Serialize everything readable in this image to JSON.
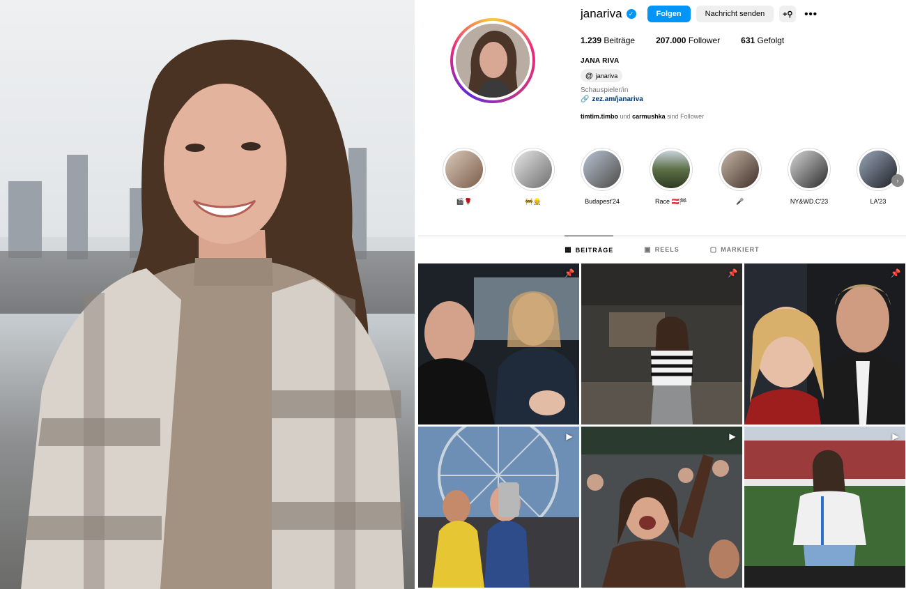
{
  "profile": {
    "username": "janariva",
    "follow_label": "Folgen",
    "message_label": "Nachricht senden",
    "add_user_icon": "add-person-icon",
    "more_icon": "more-dots-icon",
    "posts_count": "1.239",
    "posts_label": "Beiträge",
    "followers_count": "207.000",
    "followers_label": "Follower",
    "following_count": "631",
    "following_label": "Gefolgt",
    "full_name": "JANA RIVA",
    "threads_handle": "janariva",
    "category": "Schauspieler/in",
    "link": "zez.am/janariva",
    "followed_by_1": "timtim.timbo",
    "followed_by_and": "und",
    "followed_by_2": "carmushka",
    "followed_by_suffix": "sind Follower"
  },
  "highlights": [
    {
      "label": "🎬🌹"
    },
    {
      "label": "🚧👷"
    },
    {
      "label": "Budapest'24"
    },
    {
      "label": "Race 🇦🇹🏁"
    },
    {
      "label": "🎤"
    },
    {
      "label": "NY&WD.C'23"
    },
    {
      "label": "LA'23"
    }
  ],
  "tabs": [
    {
      "label": "BEITRÄGE",
      "icon": "grid-icon"
    },
    {
      "label": "REELS",
      "icon": "reels-icon"
    },
    {
      "label": "MARKIERT",
      "icon": "tagged-icon"
    }
  ],
  "posts": [
    {
      "badge": "pin-icon"
    },
    {
      "badge": "pin-icon"
    },
    {
      "badge": "pin-icon"
    },
    {
      "badge": "reel-icon"
    },
    {
      "badge": "reel-icon"
    },
    {
      "badge": "reel-icon"
    }
  ],
  "colors": {
    "accent": "#0095f6",
    "link": "#00376b",
    "muted": "#737373"
  }
}
